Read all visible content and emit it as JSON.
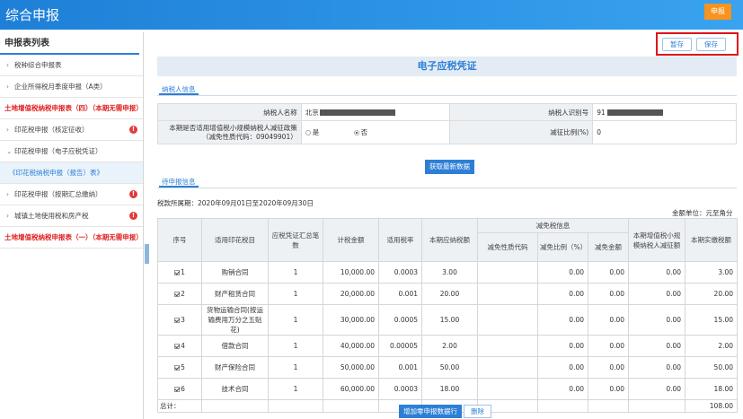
{
  "header": {
    "title": "综合申报",
    "submit_label": "申报"
  },
  "sidebar": {
    "title": "申报表列表",
    "items": [
      {
        "label": "税种综合申报表",
        "type": "normal",
        "warn": false
      },
      {
        "label": "企业所得税月季度申报（A类）",
        "type": "normal",
        "warn": false
      },
      {
        "label": "土地增值税纳税申报表（四）（本期无需申报）",
        "type": "red",
        "warn": false
      },
      {
        "label": "印花税申报（核定征收）",
        "type": "normal",
        "warn": true
      },
      {
        "label": "印花税申报（电子应税凭证）",
        "type": "open",
        "warn": false
      },
      {
        "label": "《印花税纳税申报（报告）表》",
        "type": "sub",
        "warn": false
      },
      {
        "label": "印花税申报（按期汇总缴纳）",
        "type": "normal",
        "warn": true
      },
      {
        "label": "城镇土地使用税和房产税",
        "type": "normal",
        "warn": true
      },
      {
        "label": "土地增值税纳税申报表（一）（本期无需申报）",
        "type": "red",
        "warn": false
      }
    ],
    "warn_symbol": "!"
  },
  "toolbar": {
    "save_draft_label": "暂存",
    "save_label": "保存"
  },
  "banner_title": "电子应税凭证",
  "taxpayer_tab": "纳税人信息",
  "taxpayer": {
    "name_label": "纳税人名称",
    "name_value": "北京",
    "id_label": "纳税人识别号",
    "id_value": "91",
    "policy_label": "本期是否适用增值税小规模纳税人减征政策（减免性质代码：09049901）",
    "yes_label": "是",
    "no_label": "否",
    "selected": "no",
    "rate_label": "减征比例(%)",
    "rate_value": "0"
  },
  "fetch_label": "获取最新数据",
  "declare_tab": "待申报信息",
  "period_text": "税款所属期：2020年09月01日至2020年09月30日",
  "unit_text": "金额单位：元至角分",
  "columns": {
    "seq": "序号",
    "item": "适用印花税目",
    "count": "应税凭证汇总笔数",
    "base": "计税金额",
    "rate": "适用税率",
    "payable": "本期应纳税额",
    "relief_group": "减免税信息",
    "relief_code": "减免性质代码",
    "relief_ratio": "减免比例（%）",
    "relief_amount": "减免金额",
    "small_relief": "本期增值税小规模纳税人减征额",
    "actual": "本期实缴税额"
  },
  "rows": [
    {
      "seq": "1",
      "item": "购销合同",
      "count": "1",
      "base": "10,000.00",
      "rate": "0.0003",
      "payable": "3.00",
      "code": "",
      "ratio": "0.00",
      "amount": "0.00",
      "small": "0.00",
      "actual": "3.00"
    },
    {
      "seq": "2",
      "item": "财产租赁合同",
      "count": "1",
      "base": "20,000.00",
      "rate": "0.001",
      "payable": "20.00",
      "code": "",
      "ratio": "0.00",
      "amount": "0.00",
      "small": "0.00",
      "actual": "20.00"
    },
    {
      "seq": "3",
      "item": "货物运输合同(按运输费用万分之五贴花)",
      "count": "1",
      "base": "30,000.00",
      "rate": "0.0005",
      "payable": "15.00",
      "code": "",
      "ratio": "0.00",
      "amount": "0.00",
      "small": "0.00",
      "actual": "15.00"
    },
    {
      "seq": "4",
      "item": "借款合同",
      "count": "1",
      "base": "40,000.00",
      "rate": "0.00005",
      "payable": "2.00",
      "code": "",
      "ratio": "0.00",
      "amount": "0.00",
      "small": "0.00",
      "actual": "2.00"
    },
    {
      "seq": "5",
      "item": "财产保险合同",
      "count": "1",
      "base": "50,000.00",
      "rate": "0.001",
      "payable": "50.00",
      "code": "",
      "ratio": "0.00",
      "amount": "0.00",
      "small": "0.00",
      "actual": "50.00"
    },
    {
      "seq": "6",
      "item": "技术合同",
      "count": "1",
      "base": "60,000.00",
      "rate": "0.0003",
      "payable": "18.00",
      "code": "",
      "ratio": "0.00",
      "amount": "0.00",
      "small": "0.00",
      "actual": "18.00"
    }
  ],
  "total_label": "总计：",
  "total_value": "108.00",
  "add_row_label": "增加零申报数据行",
  "delete_label": "删除"
}
